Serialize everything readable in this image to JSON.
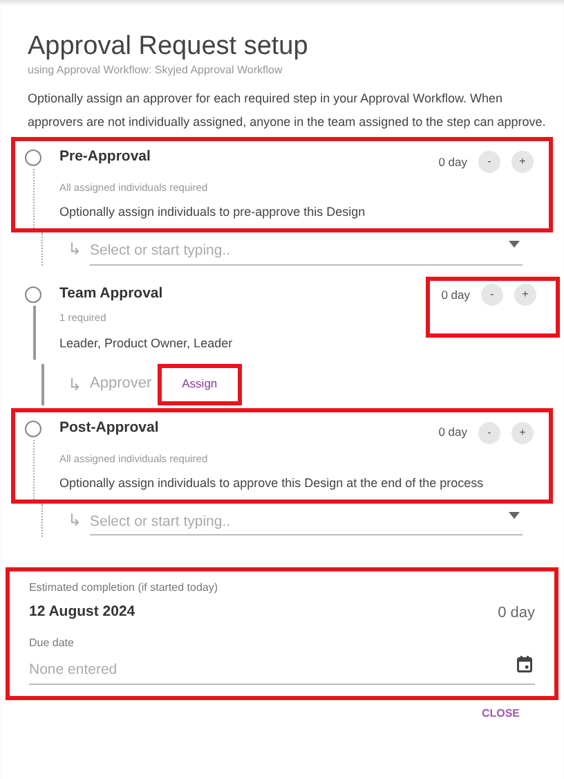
{
  "title": "Approval Request setup",
  "subtitle": "using Approval Workflow: Skyjed Approval Workflow",
  "intro": "Optionally assign an approver for each required step in your Approval Workflow. When approvers are not individually assigned, anyone in the team assigned to the step can approve.",
  "steps": [
    {
      "kind": "select",
      "title": "Pre-Approval",
      "requirement": "All assigned individuals required",
      "description": "Optionally assign individuals to pre-approve this Design",
      "duration": "0 day",
      "minus": "-",
      "plus": "+",
      "arrow": "↳",
      "placeholder": "Select or start typing..",
      "selected": false,
      "header_highlighted": true,
      "duration_highlighted": false
    },
    {
      "kind": "approver",
      "title": "Team Approval",
      "requirement": "1 required",
      "description": "Leader, Product Owner, Leader",
      "duration": "0 day",
      "minus": "-",
      "plus": "+",
      "arrow": "↳",
      "approver_label": "Approver",
      "action": "Assign",
      "selected": false,
      "header_highlighted": false,
      "duration_highlighted": true,
      "action_highlighted": true
    },
    {
      "kind": "select",
      "title": "Post-Approval",
      "requirement": "All assigned individuals required",
      "description": "Optionally assign individuals to approve this Design at the end of the process",
      "duration": "0 day",
      "minus": "-",
      "plus": "+",
      "arrow": "↳",
      "placeholder": "Select or start typing..",
      "selected": false,
      "header_highlighted": true,
      "duration_highlighted": false
    }
  ],
  "summary": {
    "highlighted": true,
    "estimate_label": "Estimated completion (if started today)",
    "estimate_date": "12 August 2024",
    "estimate_days": "0 day",
    "due_label": "Due date",
    "due_placeholder": "None entered"
  },
  "close": "CLOSE"
}
